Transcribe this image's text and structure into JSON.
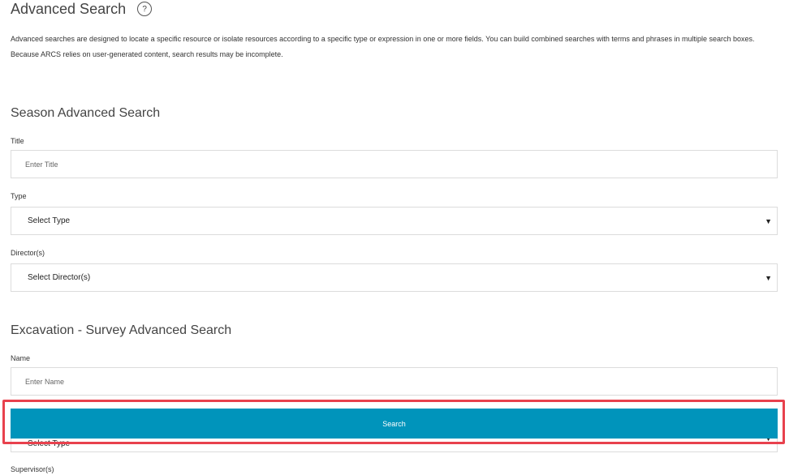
{
  "page": {
    "title": "Advanced Search",
    "help_icon": "?",
    "intro_line1": "Advanced searches are designed to locate a specific resource or isolate resources according to a specific type or expression in one or more fields. You can build combined searches with terms and phrases in multiple search boxes.",
    "intro_line2": "Because ARCS relies on user-generated content, search results may be incomplete."
  },
  "season": {
    "heading": "Season Advanced Search",
    "title_label": "Title",
    "title_placeholder": "Enter Title",
    "type_label": "Type",
    "type_value": "Select Type",
    "director_label": "Director(s)",
    "director_value": "Select Director(s)"
  },
  "excavation": {
    "heading": "Excavation - Survey Advanced Search",
    "name_label": "Name",
    "name_placeholder": "Enter Name",
    "type_value": "Select Type",
    "supervisor_label": "Supervisor(s)"
  },
  "search_button": {
    "label": "Search"
  },
  "icons": {
    "select_arrow": "▼"
  },
  "colors": {
    "accent": "#0094bb",
    "highlight": "#e8414d"
  }
}
